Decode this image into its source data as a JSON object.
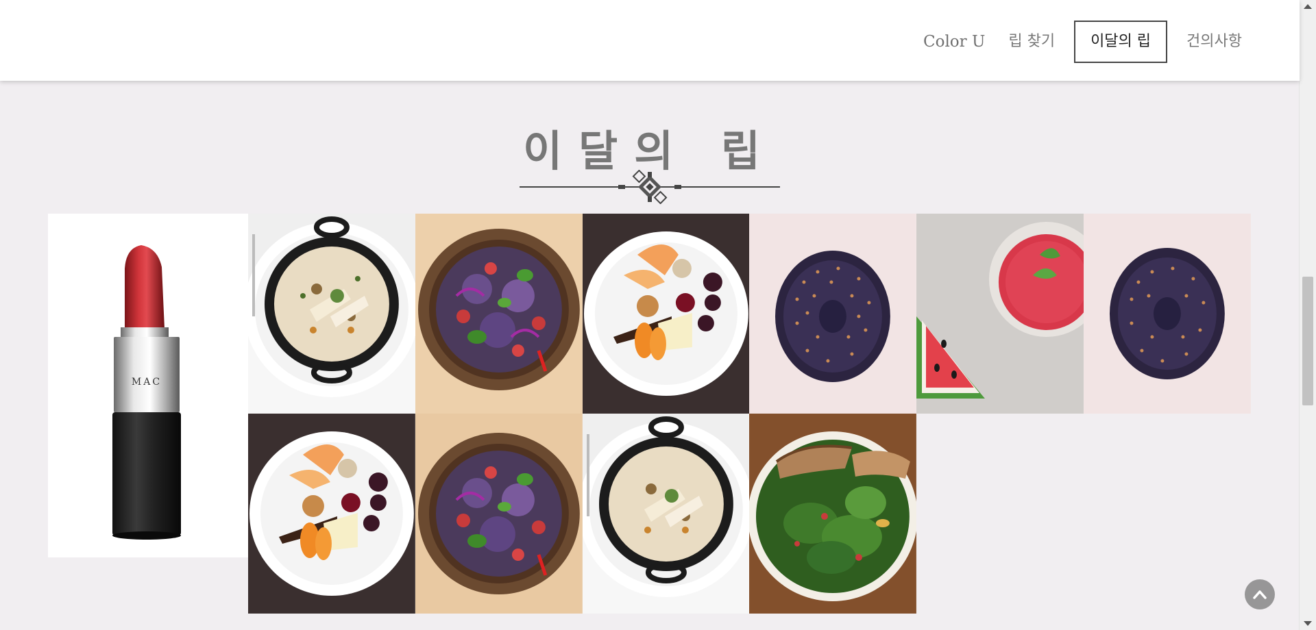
{
  "nav": {
    "brand": "Color U",
    "items": [
      {
        "label": "립 찾기",
        "active": false
      },
      {
        "label": "이달의 립",
        "active": true
      },
      {
        "label": "건의사항",
        "active": false
      }
    ]
  },
  "section": {
    "title": "이달의 립"
  },
  "feature": {
    "product_icon": "lipstick-icon",
    "brand_mark": "MAC"
  },
  "gallery": {
    "tiles": [
      {
        "subject": "oatmeal-pot"
      },
      {
        "subject": "veggie-bowl"
      },
      {
        "subject": "dessert-plate"
      },
      {
        "subject": "chocolate-donut"
      },
      {
        "subject": "watermelon-drink"
      },
      {
        "subject": "chocolate-donut"
      },
      {
        "subject": "dessert-plate"
      },
      {
        "subject": "veggie-bowl"
      },
      {
        "subject": "oatmeal-pot"
      },
      {
        "subject": "salad-bowl"
      }
    ]
  },
  "colors": {
    "page_bg": "#f1eef1",
    "header_bg": "#ffffff",
    "title": "#777777",
    "lip_red": "#b3282e"
  },
  "icons": {
    "back_to_top": "chevron-up-icon",
    "scroll_up": "scroll-up-arrow-icon",
    "scroll_down": "scroll-down-arrow-icon"
  }
}
